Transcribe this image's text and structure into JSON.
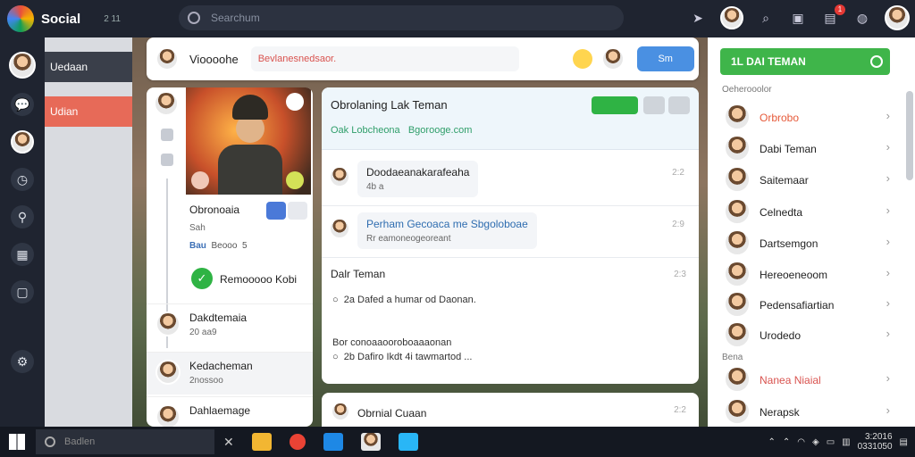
{
  "app": {
    "title": "Social",
    "subtitle": "2 11"
  },
  "search": {
    "placeholder": "Searchum"
  },
  "topbar": {
    "notification_count": "1"
  },
  "leftnav": {
    "item_active": "Uedaan",
    "item_red": "Udian"
  },
  "header": {
    "name": "Vioooohe",
    "status": "Bevlanesnedsaor.",
    "button_label": "Sm"
  },
  "profile": {
    "name": "Obronoaia",
    "small1": "Sah",
    "small2_prefix": "Bau",
    "small2": "Beooo",
    "small2_suffix": "5",
    "check_label": "Remooooo Kobi",
    "rows": [
      {
        "t1": "Dakdtemaia",
        "t2": "20 aa9"
      },
      {
        "t1": "Kedacheman",
        "t2": "2nossoo"
      },
      {
        "t1": "Dahlaemage",
        "t2": ""
      }
    ]
  },
  "chat": {
    "title": "Obrolaning Lak Teman",
    "subtitle_1": "Oak Lobcheona",
    "subtitle_2": "Bgorooge.com",
    "messages": [
      {
        "b1": "Doodaeanakarafeaha",
        "b2": "4b a",
        "time": "2:2"
      },
      {
        "b1": "Perham Gecoaca me Sbgoloboae",
        "b2": "Rr eamoneogeoreant",
        "time": "2:9"
      }
    ],
    "section_title": "Dalr Teman",
    "section_time": "2:3",
    "line1": "2a Dafed a humar od Daonan.",
    "line2_a": "Bor conoaaooroboaaaonan",
    "line2_b": "2b Dafiro Ikdt 4i tawmartod ...",
    "next_message": "Obrnial Cuaan",
    "next_time": "2:2"
  },
  "right_panel": {
    "header": "1L DAI TEMAN",
    "subheader": "Oeherooolor",
    "section2": "Bena",
    "contacts": [
      {
        "name": "Orbrobo",
        "color": "#e65a3a"
      },
      {
        "name": "Dabi Teman",
        "color": "#222222"
      },
      {
        "name": "Saitemaar",
        "color": "#222222"
      },
      {
        "name": "Celnedta",
        "color": "#222222"
      },
      {
        "name": "Dartsemgon",
        "color": "#222222"
      },
      {
        "name": "Hereoeneoom",
        "color": "#222222"
      },
      {
        "name": "Pedensafiartian",
        "color": "#222222"
      },
      {
        "name": "Urodedo",
        "color": "#222222"
      },
      {
        "name": "Nanea Niaial",
        "color": "#d9534f"
      },
      {
        "name": "Nerapsk",
        "color": "#222222"
      }
    ]
  },
  "taskbar": {
    "search_placeholder": "Badlen",
    "clock_time": "3:2016",
    "clock_date": "0331050"
  }
}
